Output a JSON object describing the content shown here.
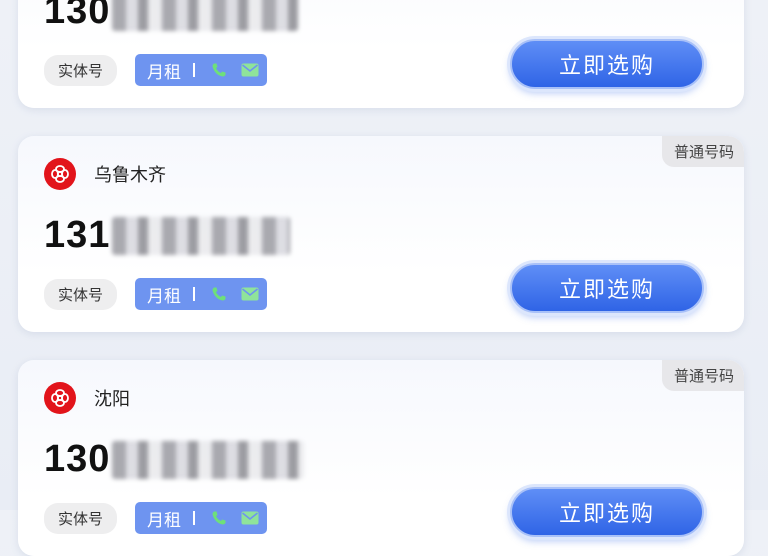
{
  "cards": [
    {
      "badge": "",
      "city": "",
      "number_visible": "130",
      "type_tag": "实体号",
      "feature_label": "月租",
      "buy_label": "立即选购"
    },
    {
      "badge": "普通号码",
      "city": "乌鲁木齐",
      "number_visible": "131",
      "type_tag": "实体号",
      "feature_label": "月租",
      "buy_label": "立即选购"
    },
    {
      "badge": "普通号码",
      "city": "沈阳",
      "number_visible": "130",
      "type_tag": "实体号",
      "feature_label": "月租",
      "buy_label": "立即选购"
    }
  ],
  "colors": {
    "brand_red": "#e2141b",
    "feature_blue": "#6e94f0",
    "button_blue": "#2f64e6",
    "phone_green": "#6ee07a",
    "mail_green": "#8fe39a"
  },
  "icons": [
    "china-unicom-logo-icon",
    "phone-icon",
    "mail-icon"
  ]
}
